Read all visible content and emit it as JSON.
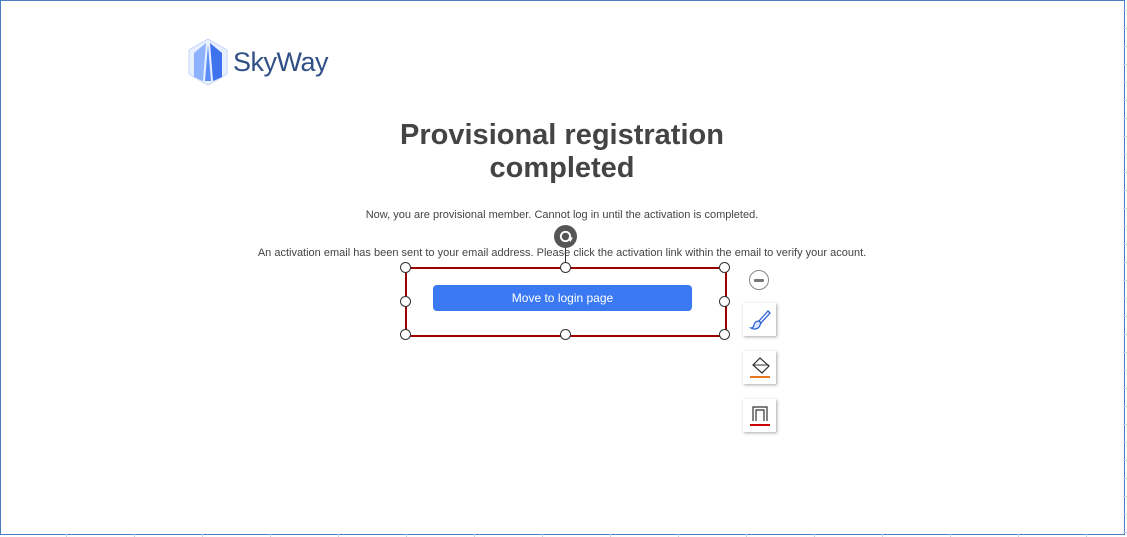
{
  "brand": {
    "name": "SkyWay",
    "colors": {
      "logo_light": "#8fb2ff",
      "logo_dark": "#3f73ee",
      "text": "#2f4f86"
    }
  },
  "page": {
    "title_line1": "Provisional registration",
    "title_line2": "completed",
    "message1": "Now, you are provisional member. Cannot log in until the activation is completed.",
    "message2": "An activation email has been sent to your email address. Please click the activation link within the email to verify your acount.",
    "login_button": "Move to login page"
  },
  "editor": {
    "selection_color": "#9a0000",
    "tools": [
      "rotate-icon",
      "minus-icon",
      "brush-icon",
      "fill-bucket-icon",
      "border-icon"
    ],
    "fill_color": "#e87722",
    "border_color": "#cc0000"
  }
}
